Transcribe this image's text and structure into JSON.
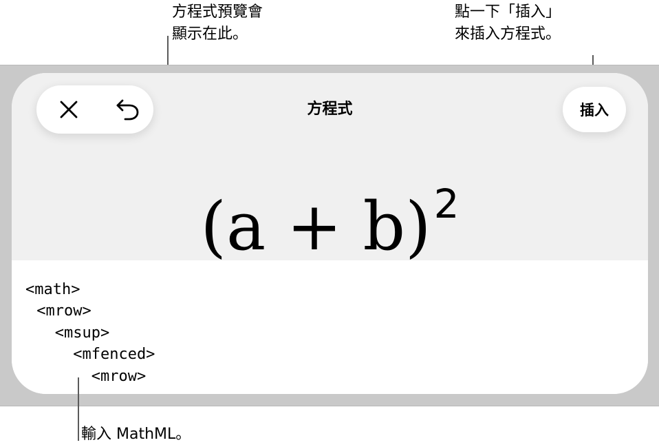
{
  "callouts": {
    "preview": {
      "line1": "方程式預覽會",
      "line2": "顯示在此。"
    },
    "insert": {
      "line1": "點一下「插入」",
      "line2": "來插入方程式。"
    },
    "input": {
      "text": "輸入 MathML。"
    }
  },
  "sheet": {
    "title": "方程式",
    "insert_label": "插入",
    "close_icon": "close-icon",
    "undo_icon": "undo-icon"
  },
  "preview": {
    "equation_base": "(a + b)",
    "equation_sup": "2"
  },
  "code": {
    "lines": [
      "<math>",
      " <mrow>",
      "   <msup>",
      "     <mfenced>",
      "       <mrow>"
    ]
  }
}
